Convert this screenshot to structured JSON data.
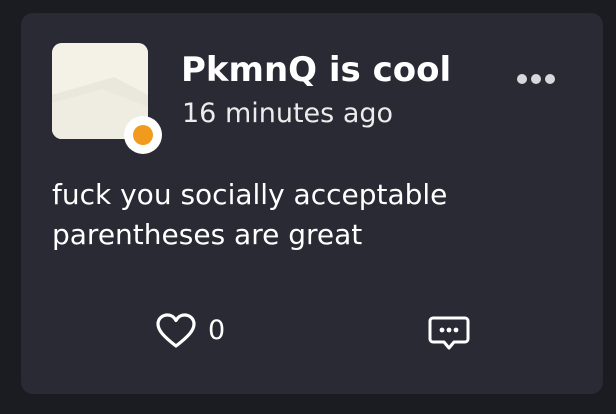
{
  "post": {
    "username": "PkmnQ is cool",
    "timestamp": "16 minutes ago",
    "text": "fuck you socially acceptable parentheses are great",
    "like_count": "0"
  },
  "icons": {
    "more": "more-horizontal-icon",
    "like": "heart-icon",
    "comment": "comment-icon"
  },
  "colors": {
    "background": "#1b1b22",
    "card": "#2a2a34",
    "text": "#ffffff",
    "status": "#f09a1e",
    "icon": "#d8d8dc"
  }
}
